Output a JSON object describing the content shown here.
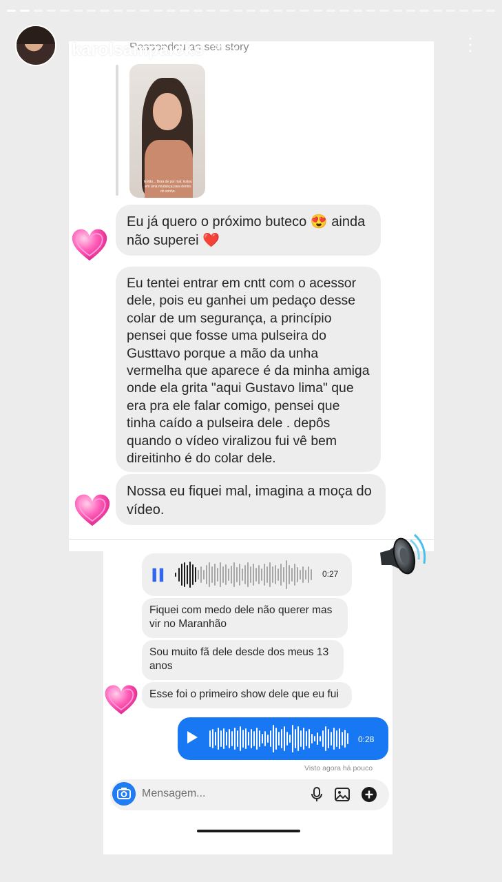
{
  "story": {
    "username": "karolsampaioks",
    "time": "20 h",
    "reply_label": "Respondeu ao seu story",
    "story_caption": "Então... Bora de por mal. Estou em uma mudança para dentro do sonho."
  },
  "messages": {
    "m1": "Eu já quero o próximo buteco 😍 ainda não superei ❤️",
    "m2": "Eu tentei entrar em cntt com o acessor dele, pois eu ganhei um pedaço desse colar de um segurança, a princípio pensei que fosse uma pulseira do Gusttavo porque a mão da unha vermelha que aparece é da minha amiga onde ela grita \"aqui Gustavo lima\" que era pra ele falar comigo, pensei que tinha caído a pulseira dele . depôs quando o vídeo viralizou fui vê bem direitinho é do colar dele.",
    "m3": "Nossa eu fiquei mal, imagina a moça do vídeo."
  },
  "chat": {
    "voice_in_duration": "0:27",
    "voice_in_state": "pause",
    "msg1": "Fiquei com medo dele não querer mas vir no Maranhão",
    "msg2": "Sou muito fã dele desde dos meus 13 anos",
    "msg3": "Esse foi o primeiro show dele que eu fui",
    "voice_out_duration": "0:28",
    "voice_out_state": "play",
    "seen_status": "Visto agora há pouco",
    "composer_placeholder": "Mensagem..."
  },
  "icons": {
    "more": "more-vertical-icon",
    "camera": "camera-icon",
    "mic": "microphone-icon",
    "gallery": "image-icon",
    "plus": "plus-circle-icon",
    "stickers": "pink-heart-sticker",
    "speaker": "speaker-sticker"
  },
  "colors": {
    "accent_blue": "#1877f2",
    "bubble_gray": "#ededed",
    "story_bg": "#ececec"
  }
}
